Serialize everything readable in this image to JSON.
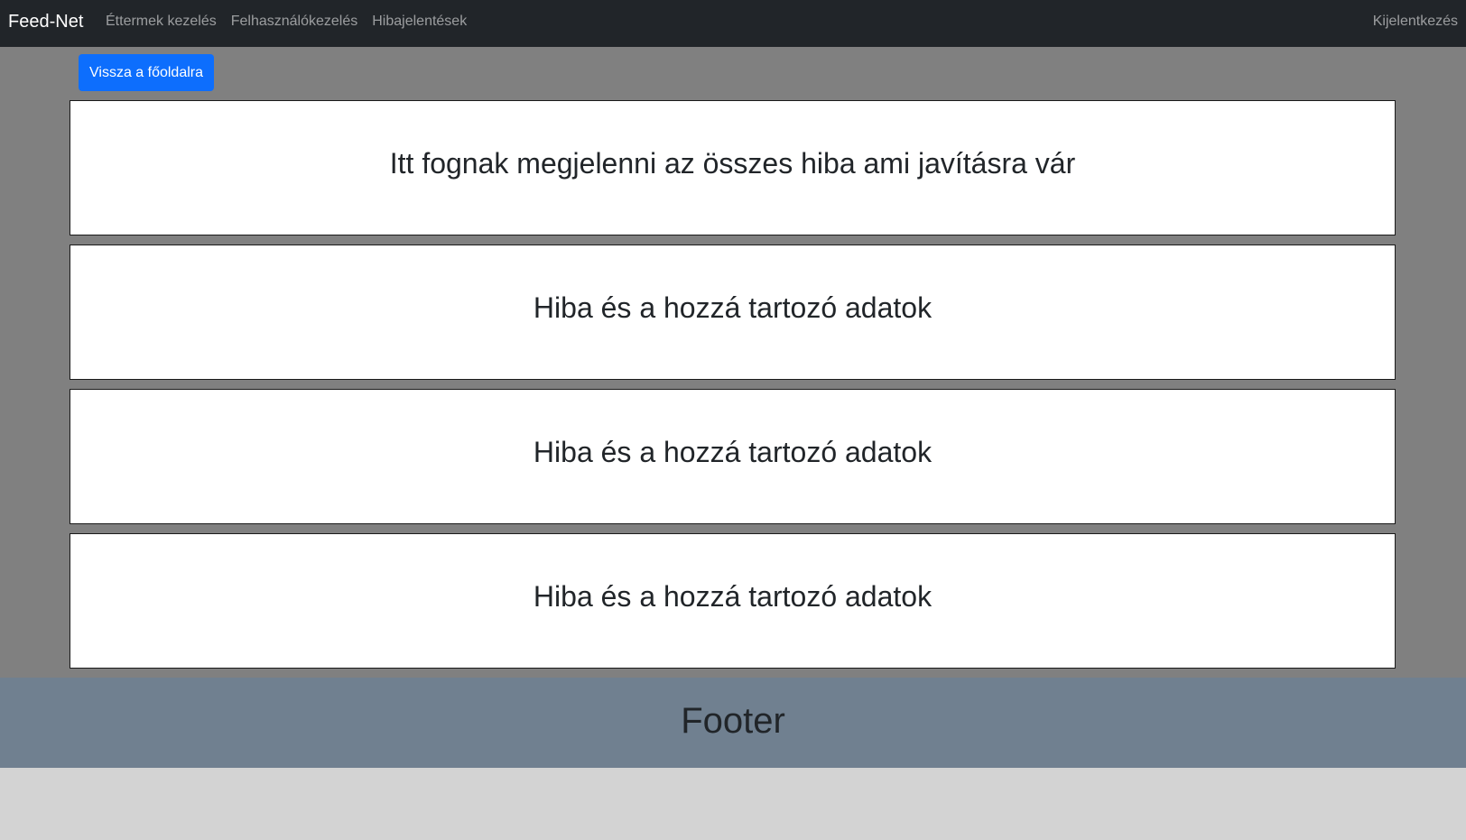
{
  "navbar": {
    "brand": "Feed-Net",
    "links": [
      "Éttermek kezelés",
      "Felhasználókezelés",
      "Hibajelentések"
    ],
    "logout": "Kijelentkezés"
  },
  "main": {
    "back_button": "Vissza a főoldalra",
    "cards": [
      "Itt fognak megjelenni az összes hiba ami javításra vár",
      "Hiba és a hozzá tartozó adatok",
      "Hiba és a hozzá tartozó adatok",
      "Hiba és a hozzá tartozó adatok"
    ]
  },
  "footer": {
    "text": "Footer"
  },
  "colors": {
    "navbar": "#212529",
    "main_bg": "#808080",
    "primary": "#0d6efd",
    "footer_bg": "#708090",
    "page_bg": "#d3d3d3"
  }
}
